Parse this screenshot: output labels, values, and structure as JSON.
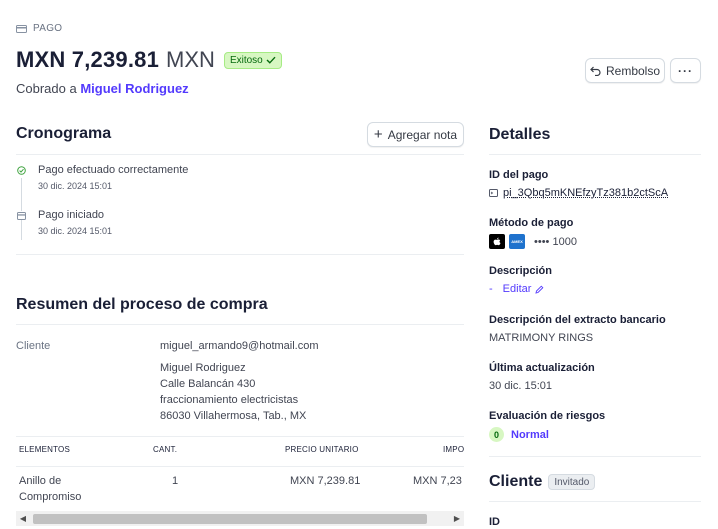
{
  "header": {
    "type_label": "PAGO",
    "amount": "MXN 7,239.81",
    "currency": "MXN",
    "status": "Exitoso",
    "charged_prefix": "Cobrado a",
    "customer_name": "Miguel Rodriguez",
    "refund_label": "Rembolso",
    "more_label": "···"
  },
  "timeline": {
    "title": "Cronograma",
    "add_note_label": "Agregar nota",
    "events": [
      {
        "title": "Pago efectuado correctamente",
        "time": "30 dic. 2024 15:01",
        "icon": "check-circle-icon"
      },
      {
        "title": "Pago iniciado",
        "time": "30 dic. 2024 15:01",
        "icon": "payment-icon"
      }
    ]
  },
  "checkout": {
    "title": "Resumen del proceso de compra",
    "customer_label": "Cliente",
    "email": "miguel_armando9@hotmail.com",
    "address_lines": [
      "Miguel Rodriguez",
      "Calle Balancán 430",
      "fraccionamiento electricistas",
      "86030 Villahermosa, Tab., MX"
    ],
    "columns": [
      "ELEMENTOS",
      "CANT.",
      "PRECIO UNITARIO",
      "IMPO"
    ],
    "rows": [
      {
        "item_line1": "Anillo de",
        "item_line2": "Compromiso",
        "qty": "1",
        "unit_price": "MXN 7,239.81",
        "amount": "MXN 7,23"
      }
    ]
  },
  "details": {
    "title": "Detalles",
    "payment_id_label": "ID del pago",
    "payment_id": "pi_3Qbq5mKNEfzyTz381b2ctScA",
    "method_label": "Método de pago",
    "card_last4": "•••• 1000",
    "description_label": "Descripción",
    "description_value": "-",
    "edit_label": "Editar",
    "statement_label": "Descripción del extracto bancario",
    "statement_value": "MATRIMONY RINGS",
    "updated_label": "Última actualización",
    "updated_value": "30 dic. 15:01",
    "risk_label": "Evaluación de riesgos",
    "risk_score": "0",
    "risk_value": "Normal"
  },
  "customer": {
    "title": "Cliente",
    "badge": "Invitado",
    "id_label": "ID"
  },
  "colors": {
    "accent": "#533afd",
    "success_bg": "#d7f7c2",
    "success_text": "#05690d"
  }
}
